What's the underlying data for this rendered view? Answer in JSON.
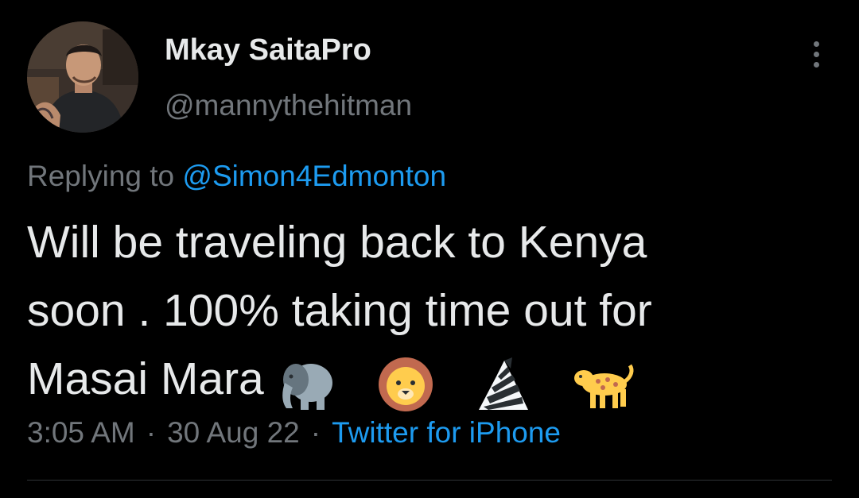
{
  "author": {
    "display_name": "Mkay SaitaPro",
    "handle": "@mannythehitman",
    "avatar_icon": "profile-photo"
  },
  "menu": {
    "icon": "more-vertical-icon"
  },
  "reply": {
    "prefix": "Replying to",
    "mention": "@Simon4Edmonton"
  },
  "tweet": {
    "lines": [
      "Will be traveling back to Kenya",
      "soon . 100% taking time out for",
      "Masai Mara"
    ],
    "emojis": [
      "elephant-emoji",
      "lion-face-emoji",
      "zebra-emoji",
      "leopard-emoji"
    ]
  },
  "meta": {
    "time": "3:05 AM",
    "separator": "·",
    "date": "30 Aug 22",
    "source": "Twitter for iPhone"
  },
  "colors": {
    "background": "#000000",
    "text": "#e7e9ea",
    "secondary": "#71767b",
    "link": "#1d9bf0",
    "divider": "#2f3336"
  }
}
